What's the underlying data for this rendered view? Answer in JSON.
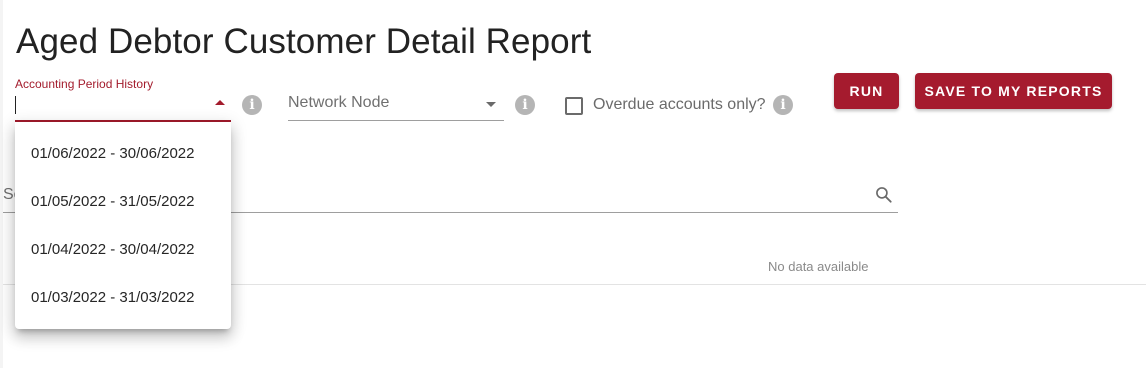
{
  "page": {
    "title": "Aged Debtor Customer Detail Report"
  },
  "filters": {
    "period": {
      "label": "Accounting Period History",
      "value": "",
      "options": [
        "01/06/2022 - 30/06/2022",
        "01/05/2022 - 31/05/2022",
        "01/04/2022 - 30/04/2022",
        "01/03/2022 - 31/03/2022"
      ]
    },
    "network": {
      "placeholder": "Network Node"
    },
    "overdue": {
      "label": "Overdue accounts only?",
      "checked": false
    },
    "info_glyph": "i"
  },
  "actions": {
    "run_label": "RUN",
    "save_label": "SAVE TO MY REPORTS"
  },
  "search": {
    "visible_text": "Se",
    "icon": "search-icon"
  },
  "table": {
    "empty_text": "No data available"
  },
  "colors": {
    "accent": "#a51b2e",
    "muted": "#707070",
    "info_icon": "#b5b5b5"
  }
}
